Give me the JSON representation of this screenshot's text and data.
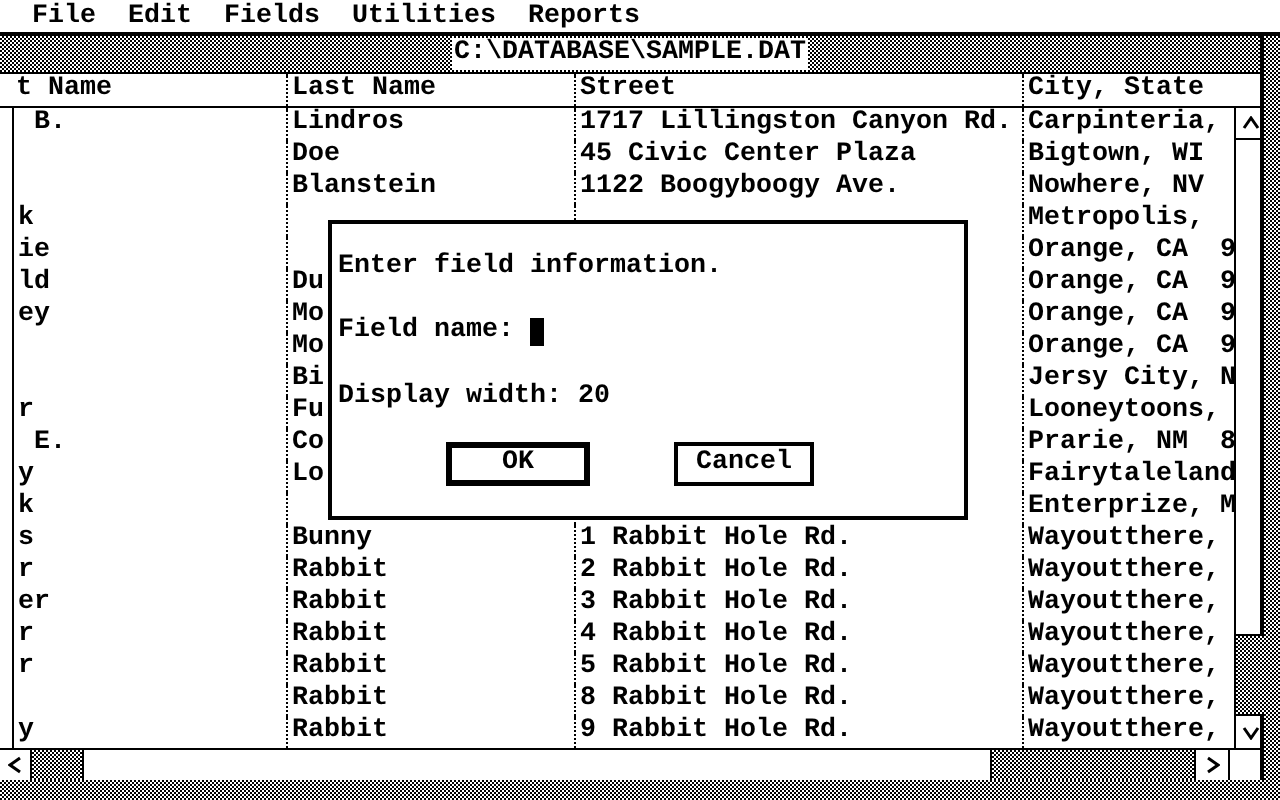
{
  "menu": [
    "File",
    "Edit",
    "Fields",
    "Utilities",
    "Reports"
  ],
  "window": {
    "title": "C:\\DATABASE\\SAMPLE.DAT"
  },
  "table": {
    "columns": [
      "t Name",
      "Last Name",
      "Street",
      "City, State"
    ],
    "rows": [
      {
        "column_1": " B.",
        "last_name": "Lindros",
        "street": "1717 Lillingston Canyon Rd.",
        "city_state": "Carpinteria,"
      },
      {
        "last_name": "Doe",
        "street": "45 Civic Center Plaza",
        "city_state": "Bigtown, WI"
      },
      {
        "last_name": "Blanstein",
        "street": "1122 Boogyboogy Ave.",
        "city_state": "Nowhere, NV"
      },
      {
        "column_1": "k",
        "city_state": "Metropolis,"
      },
      {
        "column_1": "ie",
        "city_state": "Orange, CA  9"
      },
      {
        "column_1": "ld",
        "last_name": "Du",
        "city_state": "Orange, CA  9"
      },
      {
        "column_1": "ey",
        "last_name": "Mo",
        "city_state": "Orange, CA  9"
      },
      {
        "last_name": "Mo",
        "city_state": "Orange, CA  9"
      },
      {
        "last_name": "Bi",
        "city_state": "Jersy City, N"
      },
      {
        "column_1": "r",
        "last_name": "Fu",
        "city_state": "Looneytoons,"
      },
      {
        "column_1": " E.",
        "last_name": "Co",
        "city_state": "Prarie, NM  8"
      },
      {
        "column_1": "y",
        "last_name": "Lo",
        "city_state": "Fairytaleland"
      },
      {
        "column_1": "k",
        "city_state": "Enterprize, M"
      },
      {
        "column_1": "s",
        "last_name": "Bunny",
        "street": "1 Rabbit Hole Rd.",
        "city_state": "Wayoutthere,"
      },
      {
        "column_1": "r",
        "last_name": "Rabbit",
        "street": "2 Rabbit Hole Rd.",
        "city_state": "Wayoutthere,"
      },
      {
        "column_1": "er",
        "last_name": "Rabbit",
        "street": "3 Rabbit Hole Rd.",
        "city_state": "Wayoutthere,"
      },
      {
        "column_1": "r",
        "last_name": "Rabbit",
        "street": "4 Rabbit Hole Rd.",
        "city_state": "Wayoutthere,"
      },
      {
        "column_1": "r",
        "last_name": "Rabbit",
        "street": "5 Rabbit Hole Rd.",
        "city_state": "Wayoutthere,"
      },
      {
        "last_name": "Rabbit",
        "street": "8 Rabbit Hole Rd.",
        "city_state": "Wayoutthere,"
      },
      {
        "column_1": "y",
        "last_name": "Rabbit",
        "street": "9 Rabbit Hole Rd.",
        "city_state": "Wayoutthere,"
      }
    ]
  },
  "dialog": {
    "message": "Enter field information.",
    "field_label": "Field name:",
    "width_text": "Display width: 20",
    "buttons": [
      {
        "label": "OK",
        "default": true
      },
      {
        "label": "Cancel",
        "default": false
      }
    ]
  }
}
